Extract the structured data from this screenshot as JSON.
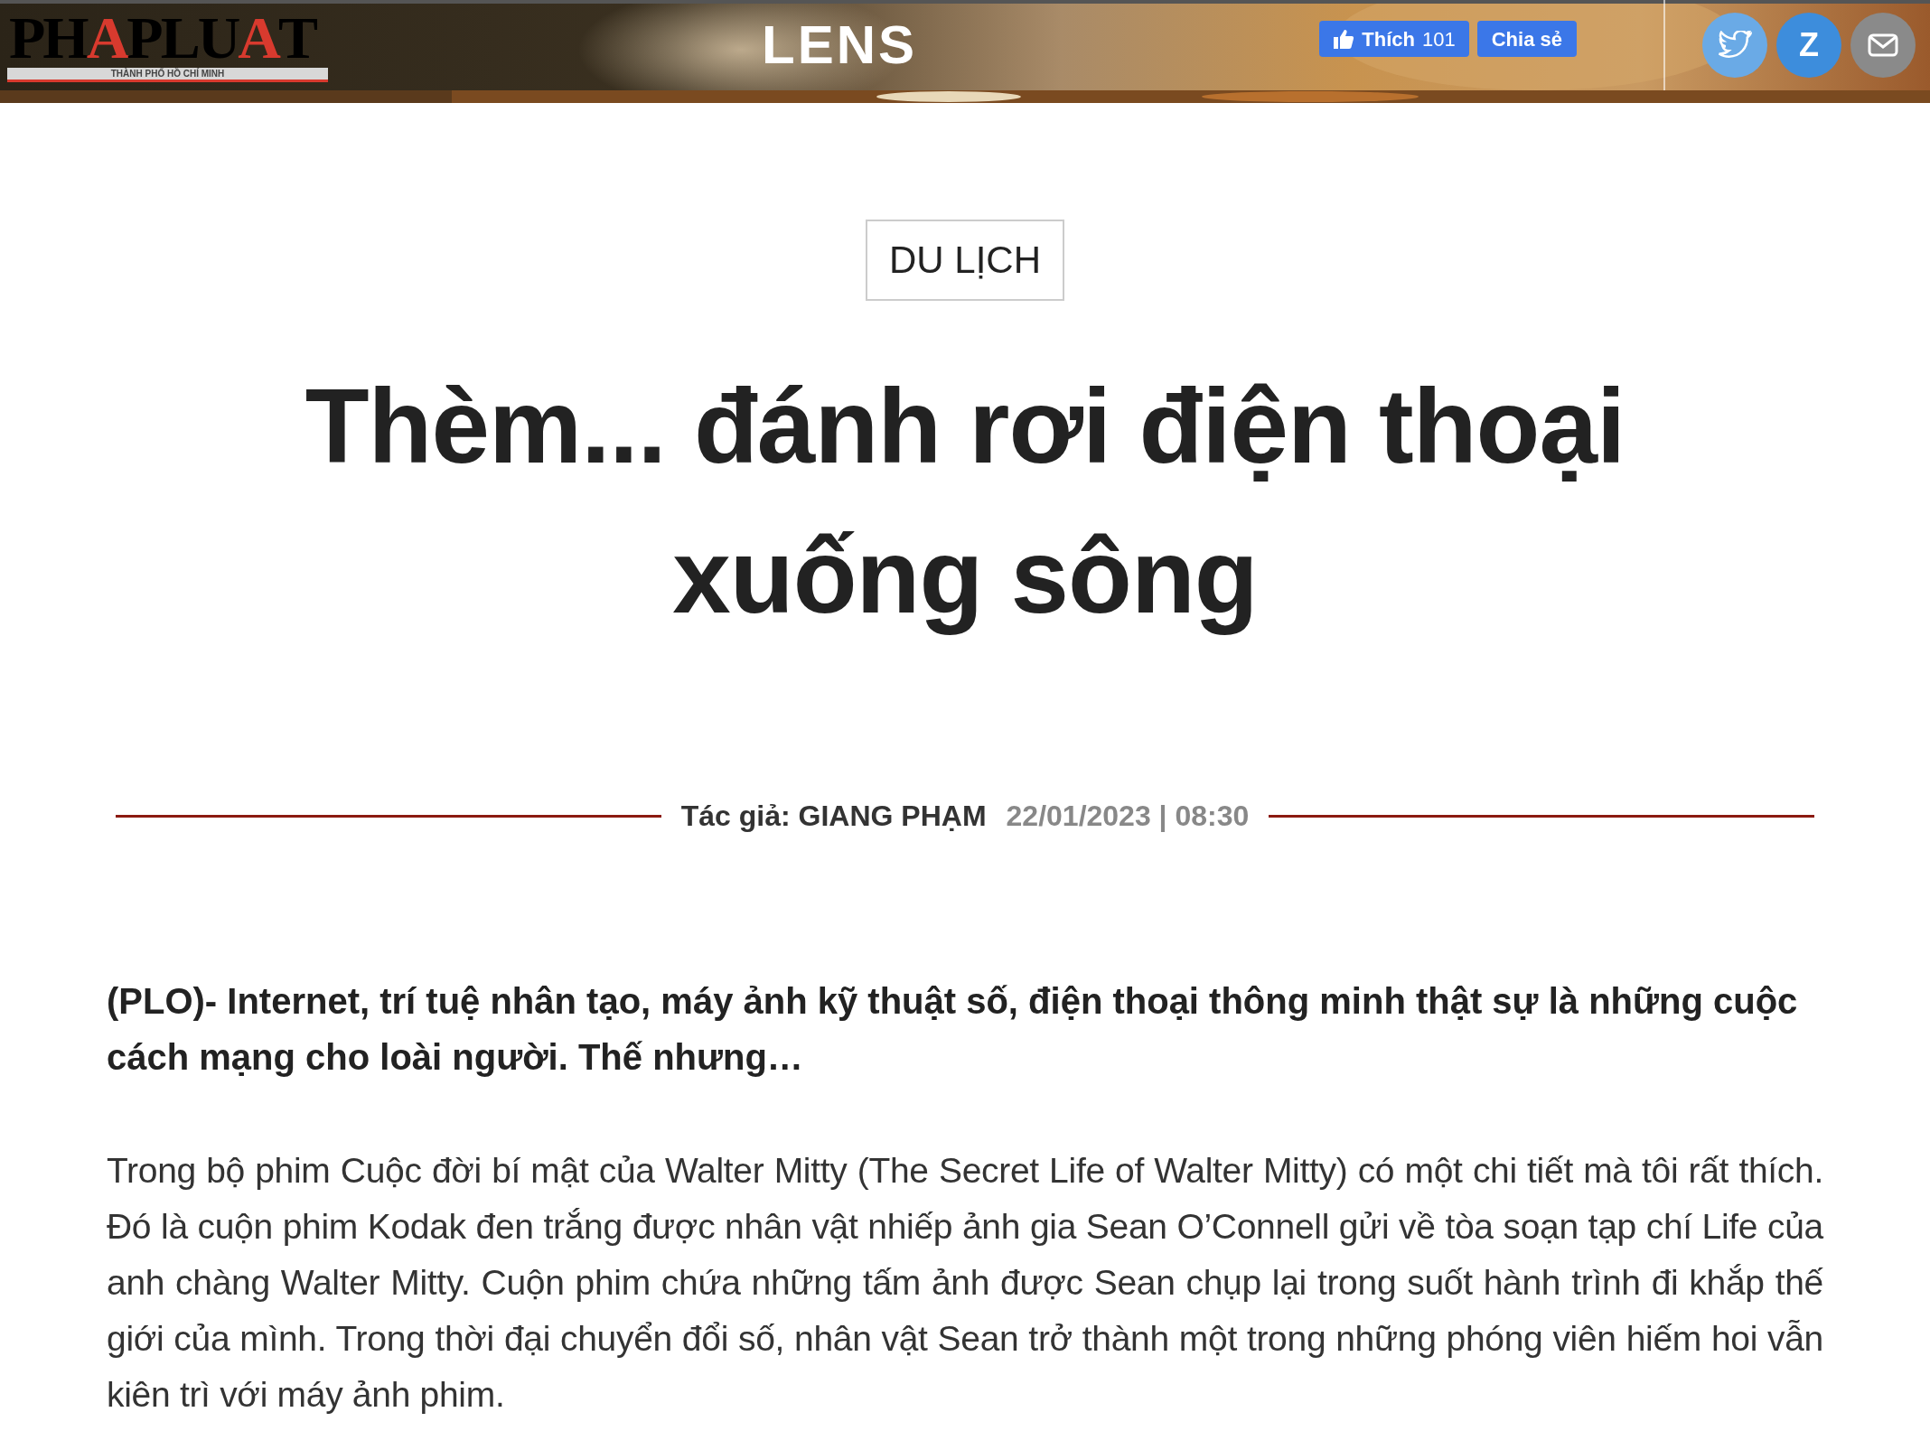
{
  "header": {
    "logo": {
      "wordmark": [
        "PH",
        "A",
        "PLU",
        "A",
        "T"
      ],
      "tagline": "THÀNH PHỐ HỒ CHÍ MINH"
    },
    "section": "LENS",
    "like_button": {
      "label": "Thích",
      "count": "101"
    },
    "share_button": {
      "label": "Chia sẻ"
    },
    "social": [
      {
        "kind": "twitter"
      },
      {
        "kind": "zalo",
        "letter": "Z"
      },
      {
        "kind": "email"
      }
    ]
  },
  "article": {
    "category": "DU LỊCH",
    "title": "Thèm... đánh rơi điện thoại xuống sông",
    "author": "Tác giả: GIANG PHẠM",
    "datetime": "22/01/2023 | 08:30",
    "lead": "(PLO)- Internet, trí tuệ nhân tạo, máy ảnh kỹ thuật số, điện thoại thông minh thật sự là những cuộc cách mạng cho loài người. Thế nhưng…",
    "body": "Trong bộ phim Cuộc đời bí mật của Walter Mitty (The Secret Life of Walter Mitty) có một chi tiết mà tôi rất thích. Đó là cuộn phim Kodak đen trắng được nhân vật nhiếp ảnh gia Sean O’Connell gửi về tòa soạn tạp chí Life của anh chàng Walter Mitty. Cuộn phim chứa những tấm ảnh được Sean chụp lại trong suốt hành trình đi khắp thế giới của mình. Trong thời đại chuyển đổi số, nhân vật Sean trở thành một trong những phóng viên hiếm hoi vẫn kiên trì với máy ảnh phim."
  }
}
